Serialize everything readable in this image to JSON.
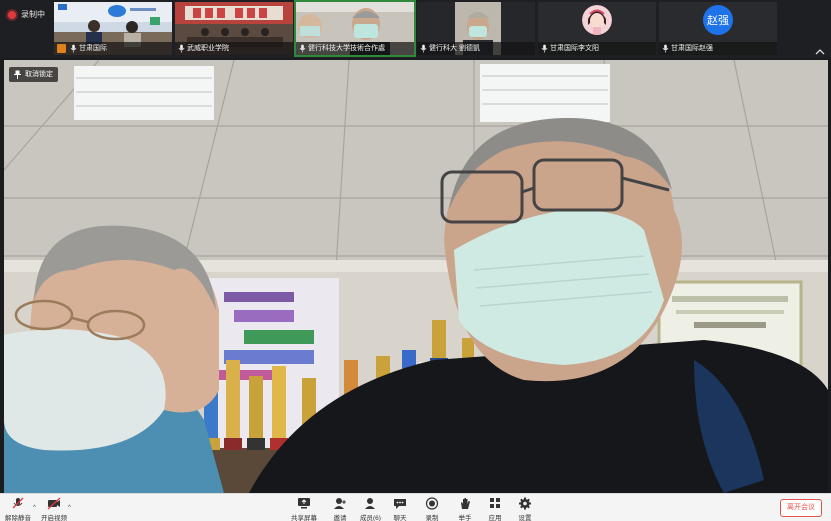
{
  "recording": {
    "label": "录制中"
  },
  "participants": [
    {
      "name": "甘肃国际",
      "icon": "person-badge"
    },
    {
      "name": "武威职业学院",
      "icon": "mic-icon"
    },
    {
      "name": "健行科技大学技術合作處",
      "icon": "mic-icon",
      "active": true
    },
    {
      "name": "健行科大 劉德凱",
      "icon": "mic-icon"
    },
    {
      "name": "甘肃国际李文阳",
      "icon": "mic-icon"
    },
    {
      "name": "甘肃国际赵强",
      "icon": "mic-icon",
      "avatar_text": "赵强"
    }
  ],
  "main_video": {
    "pin_label": "取消锁定"
  },
  "toolbar": {
    "unmute": "解除静音",
    "start_video": "开启视频",
    "share_screen": "共享屏幕",
    "invite": "邀请",
    "members": "成员(6)",
    "chat": "聊天",
    "record": "录制",
    "raise_hand": "举手",
    "apps": "应用",
    "settings": "设置",
    "leave": "离开会议"
  },
  "colors": {
    "accent_green": "#2f8b3b",
    "record_red": "#e03b3b",
    "leave_red": "#e2544d",
    "avatar_blue": "#1e73e8"
  }
}
